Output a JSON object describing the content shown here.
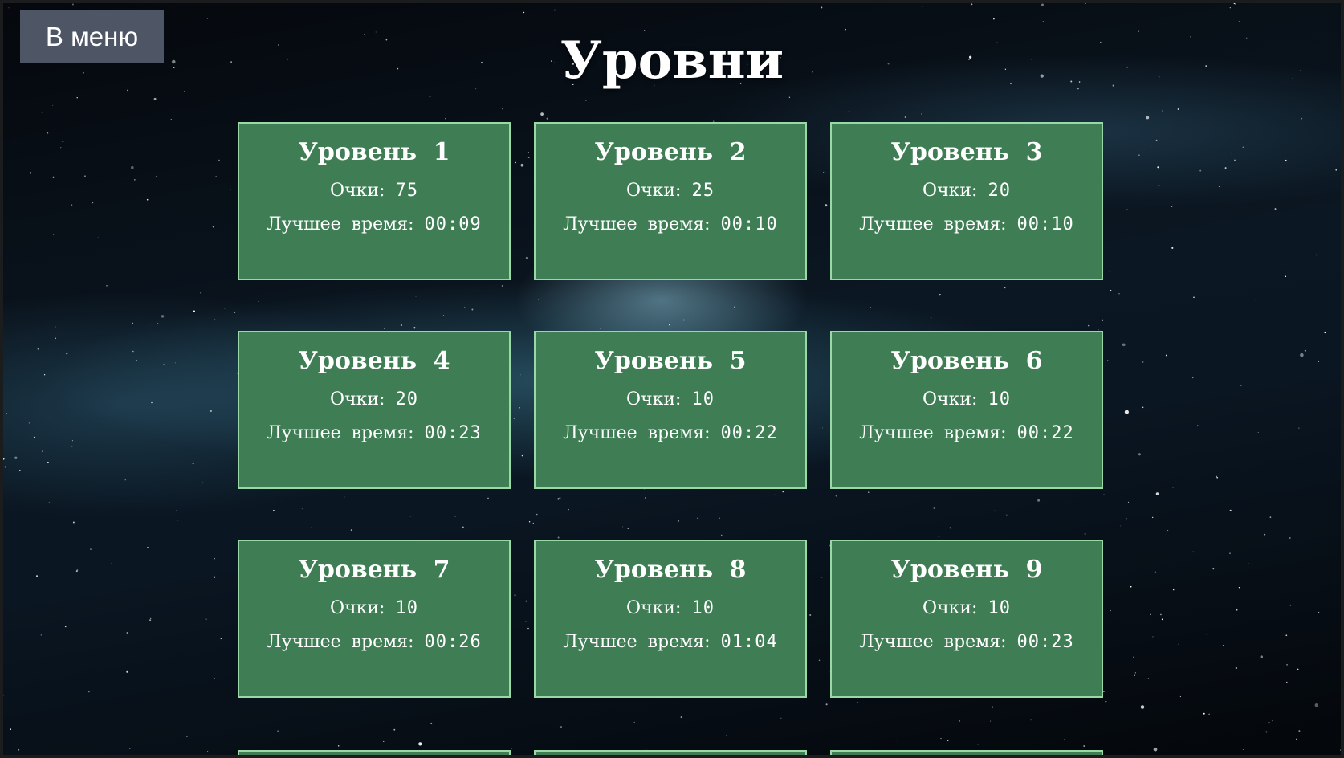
{
  "menu_button": {
    "label": "В меню"
  },
  "page": {
    "title": "Уровни"
  },
  "labels": {
    "score": "Очки:",
    "best_time": "Лучшее время:"
  },
  "colors": {
    "card_background": "#3f7e55",
    "card_border": "#9bd8a8",
    "menu_button": "#4e5666"
  },
  "levels": [
    {
      "title": "Уровень 1",
      "score": "75",
      "best_time": "00:09"
    },
    {
      "title": "Уровень 2",
      "score": "25",
      "best_time": "00:10"
    },
    {
      "title": "Уровень 3",
      "score": "20",
      "best_time": "00:10"
    },
    {
      "title": "Уровень 4",
      "score": "20",
      "best_time": "00:23"
    },
    {
      "title": "Уровень 5",
      "score": "10",
      "best_time": "00:22"
    },
    {
      "title": "Уровень 6",
      "score": "10",
      "best_time": "00:22"
    },
    {
      "title": "Уровень 7",
      "score": "10",
      "best_time": "00:26"
    },
    {
      "title": "Уровень 8",
      "score": "10",
      "best_time": "01:04"
    },
    {
      "title": "Уровень 9",
      "score": "10",
      "best_time": "00:23"
    }
  ]
}
